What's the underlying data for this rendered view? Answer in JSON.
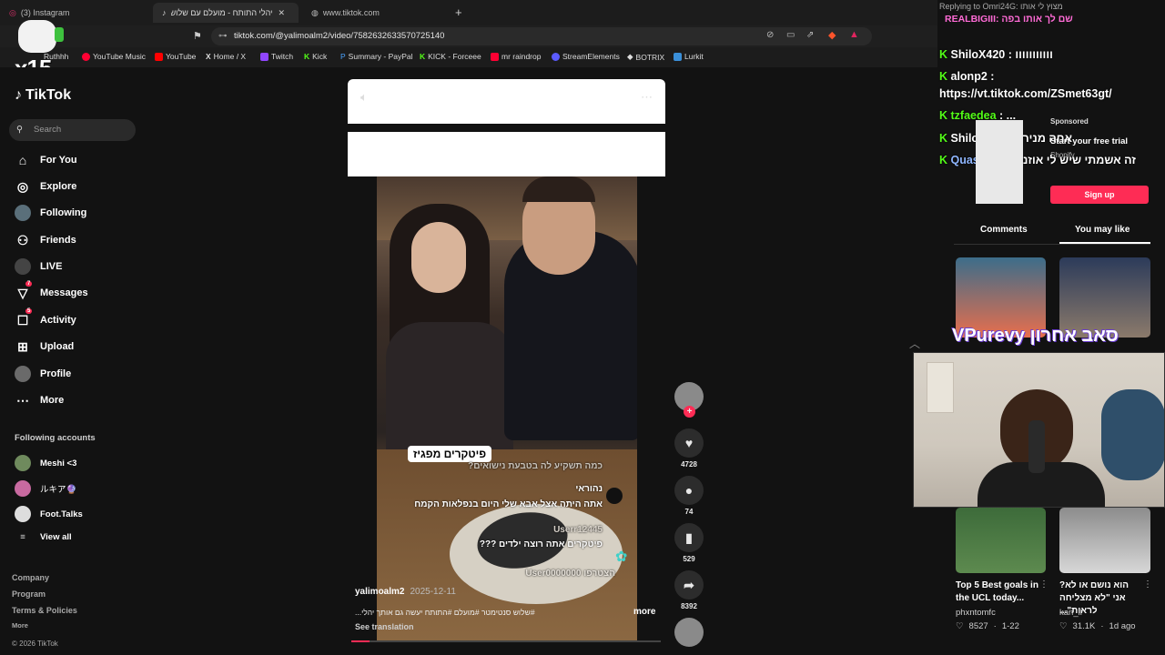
{
  "browser": {
    "tabs": [
      {
        "label": "(3) Instagram"
      },
      {
        "label": "יהלי התותח - מועלם עם שלוש סנטימ"
      },
      {
        "label": "www.tiktok.com"
      }
    ],
    "url": "tiktok.com/@yalimoalm2/video/7582632633570725140",
    "bookmarks": [
      "Ruthhh",
      "YouTube Music",
      "YouTube",
      "Home / X",
      "Twitch",
      "Kick",
      "Summary - PayPal",
      "KICK - Forceee",
      "mr raindrop",
      "StreamElements",
      "BOTRIX",
      "Lurkit"
    ]
  },
  "overlay": {
    "badge": "x15"
  },
  "tiktok": {
    "logo": "TikTok",
    "search_placeholder": "Search",
    "nav": [
      {
        "label": "For You"
      },
      {
        "label": "Explore"
      },
      {
        "label": "Following"
      },
      {
        "label": "Friends"
      },
      {
        "label": "LIVE"
      },
      {
        "label": "Messages",
        "badge": "7"
      },
      {
        "label": "Activity",
        "badge": "5"
      },
      {
        "label": "Upload"
      },
      {
        "label": "Profile"
      },
      {
        "label": "More"
      }
    ],
    "following_heading": "Following accounts",
    "following": [
      "Meshi <3",
      "ルキア🔮",
      "Foot.Talks"
    ],
    "view_all": "View all",
    "footer": [
      "Company",
      "Program",
      "Terms & Policies"
    ],
    "footer_more": "More",
    "copyright": "© 2026 TikTok"
  },
  "video": {
    "sticker": "פיטקרים מפגיז",
    "comments": [
      "כמה תשקיע לה בטבעת נישואים?",
      "נהוראי",
      "אתה היתה אצל אבא שלי היום בנפלאות הקמח",
      "Userr12445",
      "פיטקרים אתה רוצה ילדים ???",
      "User0000000 הצטרפו"
    ],
    "author": "yalimoalm2",
    "date": "2025-12-11",
    "caption": "#שלוש סנטימטר #מועלם #התותח יעשה גם אותך יהלי...",
    "more": "more",
    "see_translation": "See translation",
    "likes": "4728",
    "comments_count": "74",
    "saves": "529",
    "shares": "8392"
  },
  "chat": {
    "reply_header": "Replying to Omri24G: מצוץ לי אותו",
    "top_line": "REALBIGIII: שם לך אותו בפה",
    "messages": [
      {
        "user": "ShiloX420",
        "text": ": ווווווווווו"
      },
      {
        "user": "alonp2",
        "text": ":"
      },
      {
        "user": "",
        "text": "https://vt.tiktok.com/ZSmet63gt/"
      },
      {
        "user": "tzfaedea",
        "text": ": ..."
      },
      {
        "user": "ShiloX420",
        "text": ": אחה מנירה"
      },
      {
        "user": "Quas179",
        "text": ": זה אשמתי שיש לי אוזניים"
      }
    ]
  },
  "ads": {
    "sponsored": "Sponsored",
    "cta_text": "Start your free trial",
    "brand": "Shopify",
    "signup": "Sign up"
  },
  "panel_tabs": [
    "Comments",
    "You may like"
  ],
  "recommended": {
    "banner_text": "VPurevy סאב אחרון",
    "items": [
      {
        "title": "Top 5 Best goals in the UCL today...",
        "author": "phxntomfc",
        "likes": "8527",
        "age": "1-22"
      },
      {
        "title": "הוא נושם או לא? אני \"לא מצליחה לראות\"...",
        "author": "kan_il",
        "likes": "31.1K",
        "age": "1d ago"
      }
    ]
  },
  "colors": {
    "tiktok_red": "#fe2c55",
    "kick_green": "#53fc18"
  }
}
